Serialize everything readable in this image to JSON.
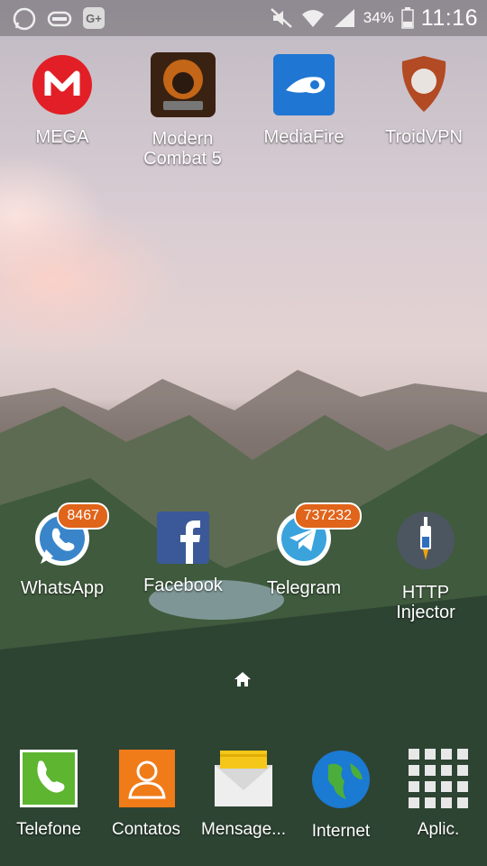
{
  "status_bar": {
    "notification_icons": [
      "whatsapp-icon",
      "gamepad-icon",
      "google-plus-icon"
    ],
    "status_icons": [
      "mute-icon",
      "wifi-icon",
      "signal-icon",
      "battery-icon"
    ],
    "battery_percent": "34%",
    "time": "11:16"
  },
  "home": {
    "top_apps": [
      {
        "label": "MEGA",
        "icon": "mega-icon",
        "color": "#e21f26"
      },
      {
        "label": "Modern\nCombat 5",
        "icon": "modern-combat-5-icon",
        "color": "#d4780e"
      },
      {
        "label": "MediaFire",
        "icon": "mediafire-icon",
        "color": "#1f76d3"
      },
      {
        "label": "TroidVPN",
        "icon": "troidvpn-icon",
        "color": "#b24a24"
      }
    ],
    "middle_apps": [
      {
        "label": "WhatsApp",
        "icon": "whatsapp-icon",
        "badge": "8467",
        "color": "#3a85c9"
      },
      {
        "label": "Facebook",
        "icon": "facebook-icon",
        "color": "#3b5998"
      },
      {
        "label": "Telegram",
        "icon": "telegram-icon",
        "badge": "737232",
        "color": "#3aa3dc"
      },
      {
        "label": "HTTP\nInjector",
        "icon": "http-injector-icon",
        "color": "#4c5660"
      }
    ],
    "home_indicator_icon": "home-icon"
  },
  "dock": [
    {
      "label": "Telefone",
      "icon": "phone-icon",
      "color": "#5db530"
    },
    {
      "label": "Contatos",
      "icon": "contacts-icon",
      "color": "#f07b19"
    },
    {
      "label": "Mensage...",
      "icon": "messages-icon",
      "color": "#f5c71a"
    },
    {
      "label": "Internet",
      "icon": "internet-icon",
      "color": "#1b7ad2"
    },
    {
      "label": "Aplic.",
      "icon": "apps-grid-icon",
      "color": "#ffffff"
    }
  ]
}
